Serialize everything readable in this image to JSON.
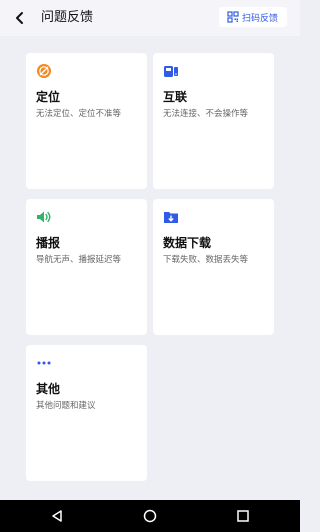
{
  "header": {
    "title": "问题反馈",
    "scan_label": "扫码反馈"
  },
  "colors": {
    "accent": "#2F5BE7",
    "location_icon": "#F08A24",
    "sound_icon": "#2FB36A",
    "background": "#EEEEF5"
  },
  "cards": [
    {
      "icon": "location-icon",
      "name": "定位",
      "desc": "无法定位、定位不准等"
    },
    {
      "icon": "car-connect-icon",
      "name": "互联",
      "desc": "无法连接、不会操作等"
    },
    {
      "icon": "speaker-icon",
      "name": "播报",
      "desc": "导航无声、播报延迟等"
    },
    {
      "icon": "download-folder-icon",
      "name": "数据下载",
      "desc": "下载失败、数据丢失等"
    },
    {
      "icon": "more-dots-icon",
      "name": "其他",
      "desc": "其他问题和建议"
    }
  ],
  "navbar": {
    "icons": [
      "back-triangle-icon",
      "home-circle-icon",
      "recents-square-icon"
    ]
  }
}
